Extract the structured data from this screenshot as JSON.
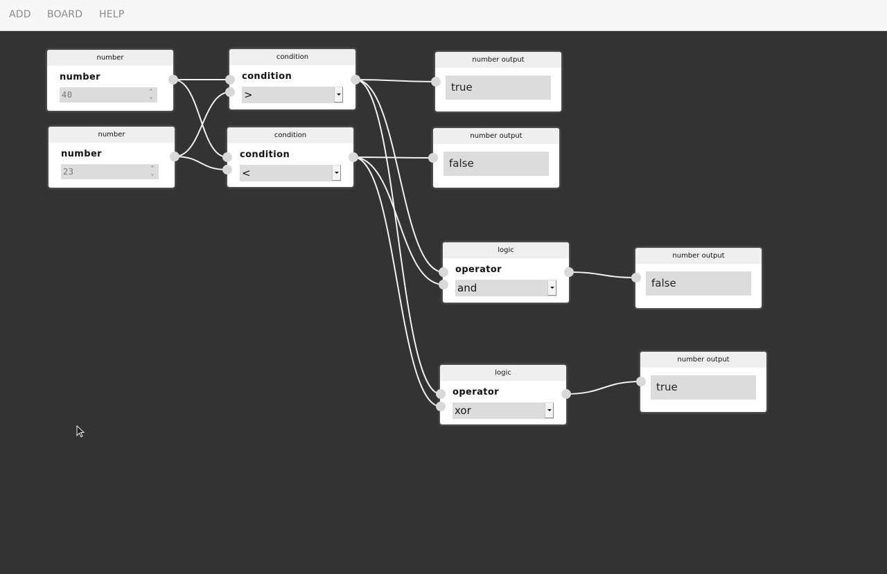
{
  "menubar": {
    "items": [
      {
        "label": "ADD"
      },
      {
        "label": "BOARD"
      },
      {
        "label": "HELP"
      }
    ]
  },
  "nodes": [
    {
      "id": "n1",
      "type": "number",
      "title": "number",
      "label": "number",
      "value": "40"
    },
    {
      "id": "n2",
      "type": "number",
      "title": "number",
      "label": "number",
      "value": "23"
    },
    {
      "id": "n3",
      "type": "condition",
      "title": "condition",
      "label": "condition",
      "selected": ">"
    },
    {
      "id": "n4",
      "type": "condition",
      "title": "condition",
      "label": "condition",
      "selected": "<"
    },
    {
      "id": "n5",
      "type": "number-output",
      "title": "number output",
      "value": "true"
    },
    {
      "id": "n6",
      "type": "number-output",
      "title": "number output",
      "value": "false"
    },
    {
      "id": "n7",
      "type": "logic",
      "title": "logic",
      "label": "operator",
      "selected": "and"
    },
    {
      "id": "n8",
      "type": "number-output",
      "title": "number output",
      "value": "false"
    },
    {
      "id": "n9",
      "type": "logic",
      "title": "logic",
      "label": "operator",
      "selected": "xor"
    },
    {
      "id": "n10",
      "type": "number-output",
      "title": "number output",
      "value": "true"
    }
  ],
  "connections": [
    {
      "from": "n1.out",
      "to": "n3.in1"
    },
    {
      "from": "n1.out",
      "to": "n4.in1"
    },
    {
      "from": "n2.out",
      "to": "n3.in2"
    },
    {
      "from": "n2.out",
      "to": "n4.in2"
    },
    {
      "from": "n3.out",
      "to": "n5.in"
    },
    {
      "from": "n4.out",
      "to": "n6.in"
    },
    {
      "from": "n3.out",
      "to": "n7.in1"
    },
    {
      "from": "n4.out",
      "to": "n7.in2"
    },
    {
      "from": "n3.out",
      "to": "n9.in1"
    },
    {
      "from": "n4.out",
      "to": "n9.in2"
    },
    {
      "from": "n7.out",
      "to": "n8.in"
    },
    {
      "from": "n9.out",
      "to": "n10.in"
    }
  ],
  "colors": {
    "canvas": "#333333",
    "menubar": "#f7f7f7",
    "wire": "#f2f2f2",
    "port": "#d9d9d9",
    "field": "#dcdcdc"
  }
}
